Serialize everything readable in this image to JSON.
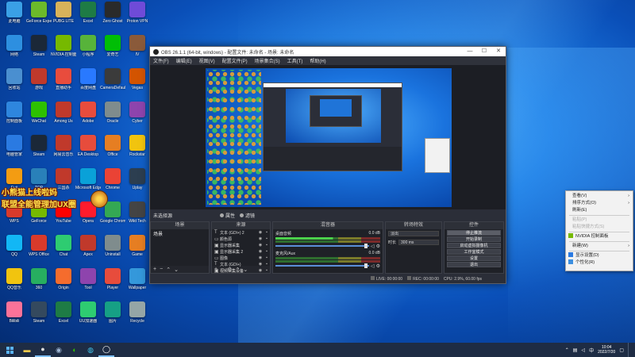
{
  "desktop": {
    "icons": [
      {
        "label": "此电脑",
        "color": "#3aa0e6"
      },
      {
        "label": "GeForce Experience",
        "color": "#6cba2a"
      },
      {
        "label": "PUBG LITE",
        "color": "#d8b25a"
      },
      {
        "label": "Excel",
        "color": "#1e7b45"
      },
      {
        "label": "Zero Ghost",
        "color": "#2a2a2a"
      },
      {
        "label": "Proton VPN",
        "color": "#6f4bd8"
      },
      {
        "label": "网络",
        "color": "#2d8fe0"
      },
      {
        "label": "Steam",
        "color": "#1b2838"
      },
      {
        "label": "NVIDIA 控制面板",
        "color": "#76b900"
      },
      {
        "label": "小程序",
        "color": "#57b33a"
      },
      {
        "label": "爱奇艺",
        "color": "#00be06"
      },
      {
        "label": "IV",
        "color": "#8a5a3a"
      },
      {
        "label": "回收站",
        "color": "#4a8fd0"
      },
      {
        "label": "游戏",
        "color": "#c0392b"
      },
      {
        "label": "直播助手",
        "color": "#e84c3d"
      },
      {
        "label": "百度网盘",
        "color": "#2979ff"
      },
      {
        "label": "CameraDefault",
        "color": "#3b3b3b"
      },
      {
        "label": "Vegas",
        "color": "#d35400"
      },
      {
        "label": "控制面板",
        "color": "#2e86de"
      },
      {
        "label": "WeChat",
        "color": "#2dc100"
      },
      {
        "label": "Among Us",
        "color": "#c0392b"
      },
      {
        "label": "Adobe",
        "color": "#e84c3d"
      },
      {
        "label": "Oracle",
        "color": "#7f8c8d"
      },
      {
        "label": "Cyber",
        "color": "#8e44ad"
      },
      {
        "label": "电脑管家",
        "color": "#2a7ae2"
      },
      {
        "label": "Steam",
        "color": "#1b2838"
      },
      {
        "label": "网易云音乐",
        "color": "#c0392b"
      },
      {
        "label": "EA Desktop",
        "color": "#e74c3c"
      },
      {
        "label": "Office",
        "color": "#e67e22"
      },
      {
        "label": "Rockstar",
        "color": "#f1c40f"
      },
      {
        "label": "Fuji",
        "color": "#f39c12"
      },
      {
        "label": "TOP",
        "color": "#2980b9"
      },
      {
        "label": "三国杀",
        "color": "#c0392b"
      },
      {
        "label": "Microsoft Edge",
        "color": "#0aa1d8"
      },
      {
        "label": "Chrome",
        "color": "#ea4335"
      },
      {
        "label": "Uplay",
        "color": "#2c3e50"
      },
      {
        "label": "WPS",
        "color": "#d93a2b"
      },
      {
        "label": "GeForce",
        "color": "#76b900"
      },
      {
        "label": "YouTube",
        "color": "#ff0000"
      },
      {
        "label": "Opera",
        "color": "#ff1b2d"
      },
      {
        "label": "Google Chrome",
        "color": "#34a853"
      },
      {
        "label": "Wild Tech",
        "color": "#444"
      },
      {
        "label": "QQ",
        "color": "#12b7f5"
      },
      {
        "label": "WPS Office",
        "color": "#d93a2b"
      },
      {
        "label": "Chat",
        "color": "#2ecc71"
      },
      {
        "label": "Apex",
        "color": "#c0392b"
      },
      {
        "label": "Uninstall",
        "color": "#7f8c8d"
      },
      {
        "label": "Game",
        "color": "#e67e22"
      },
      {
        "label": "QQ音乐",
        "color": "#f1c40f"
      },
      {
        "label": "360",
        "color": "#27ae60"
      },
      {
        "label": "Origin",
        "color": "#f56c2d"
      },
      {
        "label": "Tool",
        "color": "#8e44ad"
      },
      {
        "label": "Player",
        "color": "#e74c3c"
      },
      {
        "label": "Wallpaper",
        "color": "#3498db"
      },
      {
        "label": "Bilibili",
        "color": "#fb7299"
      },
      {
        "label": "Steam",
        "color": "#34495e"
      },
      {
        "label": "Excel",
        "color": "#1e7b45"
      },
      {
        "label": "UU加速器",
        "color": "#2ecc71"
      },
      {
        "label": "图片",
        "color": "#16a085"
      },
      {
        "label": "Recycle",
        "color": "#95a5a6"
      }
    ],
    "banner_line1": "小熊猫上线啦妈",
    "banner_line2": "联盟全能管理加UX圈"
  },
  "obs": {
    "title": "OBS 26.1.1 (64-bit, windows) - 配置文件: 未命名 - 场景: 未命名",
    "menu": [
      "文件(F)",
      "编辑(E)",
      "视图(V)",
      "配置文件(P)",
      "场景集合(S)",
      "工具(T)",
      "帮助(H)"
    ],
    "scene_bar_label": "未选择源",
    "toggle_a": "属性",
    "toggle_b": "滤镜",
    "docks": {
      "scenes": {
        "title": "场景",
        "items": [
          "场景"
        ]
      },
      "sources": {
        "title": "来源",
        "items": [
          {
            "icon": "T",
            "name": "文本 (GDI+) 2"
          },
          {
            "icon": "▭",
            "name": "颜色源"
          },
          {
            "icon": "▣",
            "name": "显示器采集"
          },
          {
            "icon": "▣",
            "name": "显示器采集 2"
          },
          {
            "icon": "▭",
            "name": "图像"
          },
          {
            "icon": "T",
            "name": "文本 (GDI+)"
          },
          {
            "icon": "▣",
            "name": "视频采集设备"
          }
        ]
      },
      "mixer": {
        "title": "混音器",
        "channels": [
          {
            "name": "桌面音频",
            "db": "0.0 dB"
          },
          {
            "name": "麦克风/Aux",
            "db": "0.0 dB"
          }
        ]
      },
      "transitions": {
        "title": "转场特效",
        "mode": "淡出",
        "duration_label": "时长",
        "duration": "300 ms"
      },
      "controls": {
        "title": "控件",
        "buttons": [
          "停止推流",
          "开始录制",
          "启动虚拟摄像机",
          "工作室模式",
          "设置",
          "退出"
        ]
      }
    },
    "status": {
      "live": "LIVE: 00:00:00",
      "rec": "REC: 00:00:00",
      "cpu": "CPU: 2.9%, 60.00 fps"
    }
  },
  "context_menu": {
    "items": [
      {
        "label": "查看(V)",
        "arrow": true,
        "disabled": false,
        "icon": ""
      },
      {
        "label": "排序方式(O)",
        "arrow": true,
        "disabled": false,
        "icon": ""
      },
      {
        "label": "刷新(E)",
        "arrow": false,
        "disabled": false,
        "icon": ""
      },
      {
        "sep": true
      },
      {
        "label": "粘贴(P)",
        "arrow": false,
        "disabled": true,
        "icon": ""
      },
      {
        "label": "粘贴快捷方式(S)",
        "arrow": false,
        "disabled": true,
        "icon": ""
      },
      {
        "sep": true
      },
      {
        "label": "NVIDIA 控制面板",
        "arrow": false,
        "disabled": false,
        "icon": "nvidia"
      },
      {
        "sep": true
      },
      {
        "label": "新建(W)",
        "arrow": true,
        "disabled": false,
        "icon": ""
      },
      {
        "sep": true
      },
      {
        "label": "显示设置(D)",
        "arrow": false,
        "disabled": false,
        "icon": "display"
      },
      {
        "label": "个性化(R)",
        "arrow": false,
        "disabled": false,
        "icon": "personalize"
      }
    ]
  },
  "taskbar": {
    "apps": [
      "file-explorer",
      "obs",
      "steam",
      "wechat",
      "edge",
      "obs-record"
    ],
    "time": "10:04",
    "date": "2022/7/20",
    "tray_lang": "中"
  }
}
